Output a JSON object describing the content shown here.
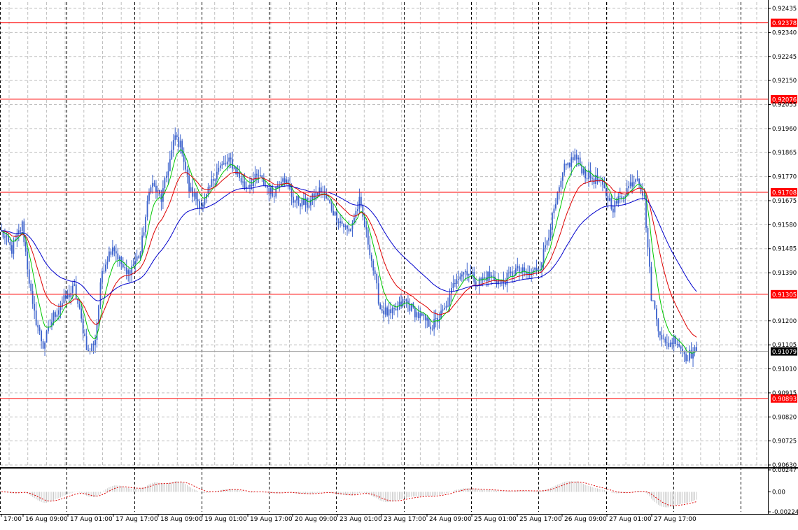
{
  "chart_data": {
    "type": "candlestick",
    "timeframe_step_hours": 1,
    "y_axis": {
      "range": [
        0.9063,
        0.9246
      ],
      "ticks": [
        0.92435,
        0.9234,
        0.92245,
        0.9215,
        0.92055,
        0.9196,
        0.91865,
        0.9177,
        0.91675,
        0.9158,
        0.91485,
        0.9139,
        0.912,
        0.91105,
        0.9101,
        0.90915,
        0.9082,
        0.90725,
        0.9063
      ]
    },
    "x_axis": {
      "tick_labels": [
        "17:00",
        "16 Aug 09:00",
        "17 Aug 01:00",
        "17 Aug 17:00",
        "18 Aug 09:00",
        "19 Aug 01:00",
        "19 Aug 17:00",
        "20 Aug 09:00",
        "23 Aug 01:00",
        "23 Aug 17:00",
        "24 Aug 09:00",
        "25 Aug 01:00",
        "25 Aug 17:00",
        "26 Aug 09:00",
        "27 Aug 01:00",
        "27 Aug 17:00"
      ]
    },
    "horizontal_levels": [
      {
        "value": 0.92378,
        "label": "0.92378",
        "color": "#ff0000"
      },
      {
        "value": 0.92076,
        "label": "0.92076",
        "color": "#ff0000"
      },
      {
        "value": 0.91708,
        "label": "0.91708",
        "color": "#ff0000"
      },
      {
        "value": 0.91305,
        "label": "0.91305",
        "color": "#ff0000"
      },
      {
        "value": 0.90893,
        "label": "0.90893",
        "color": "#ff0000"
      }
    ],
    "current_price": {
      "value": 0.91079,
      "label": "0.91079"
    },
    "price_anchors": [
      [
        0,
        0.9155
      ],
      [
        6,
        0.9148
      ],
      [
        12,
        0.9158
      ],
      [
        18,
        0.9125
      ],
      [
        24,
        0.911
      ],
      [
        30,
        0.9122
      ],
      [
        36,
        0.9128
      ],
      [
        42,
        0.9133
      ],
      [
        50,
        0.9107
      ],
      [
        54,
        0.9113
      ],
      [
        58,
        0.914
      ],
      [
        64,
        0.915
      ],
      [
        72,
        0.9138
      ],
      [
        80,
        0.9147
      ],
      [
        86,
        0.9175
      ],
      [
        92,
        0.9168
      ],
      [
        100,
        0.9193
      ],
      [
        104,
        0.9188
      ],
      [
        108,
        0.9172
      ],
      [
        116,
        0.9165
      ],
      [
        124,
        0.918
      ],
      [
        132,
        0.9183
      ],
      [
        140,
        0.9173
      ],
      [
        148,
        0.9177
      ],
      [
        156,
        0.917
      ],
      [
        162,
        0.9178
      ],
      [
        168,
        0.9168
      ],
      [
        176,
        0.9166
      ],
      [
        184,
        0.9172
      ],
      [
        192,
        0.9162
      ],
      [
        200,
        0.9155
      ],
      [
        206,
        0.9167
      ],
      [
        212,
        0.9148
      ],
      [
        218,
        0.9125
      ],
      [
        224,
        0.9122
      ],
      [
        232,
        0.9128
      ],
      [
        240,
        0.9122
      ],
      [
        248,
        0.9118
      ],
      [
        256,
        0.9125
      ],
      [
        262,
        0.9138
      ],
      [
        268,
        0.914
      ],
      [
        274,
        0.9135
      ],
      [
        280,
        0.9138
      ],
      [
        288,
        0.9135
      ],
      [
        296,
        0.914
      ],
      [
        304,
        0.9138
      ],
      [
        310,
        0.9142
      ],
      [
        318,
        0.9163
      ],
      [
        324,
        0.918
      ],
      [
        330,
        0.9185
      ],
      [
        336,
        0.9178
      ],
      [
        344,
        0.9175
      ],
      [
        352,
        0.9165
      ],
      [
        360,
        0.9172
      ],
      [
        366,
        0.9178
      ],
      [
        370,
        0.9168
      ],
      [
        374,
        0.913
      ],
      [
        378,
        0.9118
      ],
      [
        382,
        0.911
      ],
      [
        388,
        0.9113
      ],
      [
        394,
        0.9106
      ],
      [
        400,
        0.9108
      ]
    ],
    "moving_averages": [
      {
        "period": 8,
        "color": "#00c800"
      },
      {
        "period": 21,
        "color": "#dd0000"
      },
      {
        "period": 55,
        "color": "#0000cc"
      }
    ],
    "oscillator": {
      "y_ticks": [
        0.00247,
        0.0,
        -0.00224
      ],
      "range": [
        -0.00224,
        0.00247
      ],
      "tick_labels": [
        "0.00247",
        "0.00",
        "-0.00224"
      ]
    },
    "colors": {
      "candle": "#3d63cc",
      "grid": "#c0c0c0",
      "separator": "#000000",
      "level": "#ff0000",
      "price_box": "#000000",
      "histogram": "#c8c8c8",
      "signal": "#dd0000"
    }
  }
}
